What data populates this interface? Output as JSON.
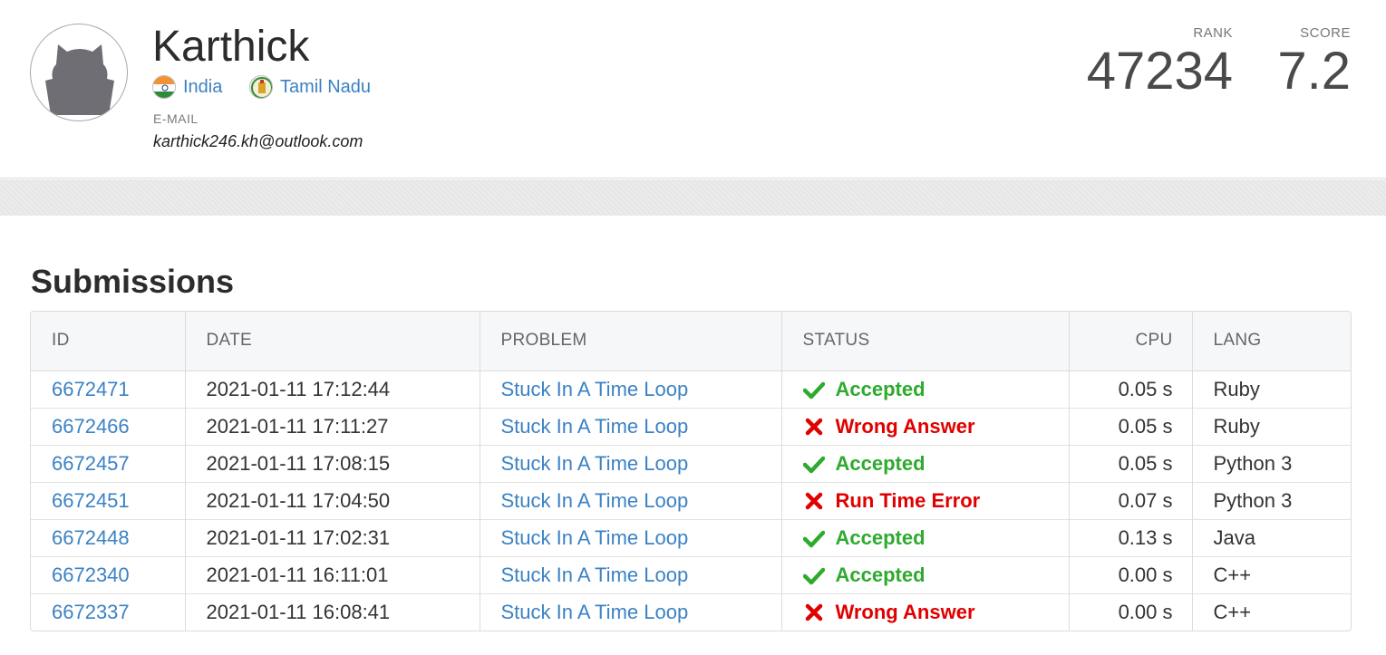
{
  "profile": {
    "name": "Karthick",
    "country": "India",
    "state": "Tamil Nadu",
    "email_label": "E-MAIL",
    "email": "karthick246.kh@outlook.com",
    "rank_label": "RANK",
    "rank": "47234",
    "score_label": "SCORE",
    "score": "7.2"
  },
  "submissions": {
    "title": "Submissions",
    "headers": {
      "id": "ID",
      "date": "DATE",
      "problem": "PROBLEM",
      "status": "STATUS",
      "cpu": "CPU",
      "lang": "LANG"
    },
    "rows": [
      {
        "id": "6672471",
        "date": "2021-01-11 17:12:44",
        "problem": "Stuck In A Time Loop",
        "status": "Accepted",
        "cpu": "0.05 s",
        "lang": "Ruby"
      },
      {
        "id": "6672466",
        "date": "2021-01-11 17:11:27",
        "problem": "Stuck In A Time Loop",
        "status": "Wrong Answer",
        "cpu": "0.05 s",
        "lang": "Ruby"
      },
      {
        "id": "6672457",
        "date": "2021-01-11 17:08:15",
        "problem": "Stuck In A Time Loop",
        "status": "Accepted",
        "cpu": "0.05 s",
        "lang": "Python 3"
      },
      {
        "id": "6672451",
        "date": "2021-01-11 17:04:50",
        "problem": "Stuck In A Time Loop",
        "status": "Run Time Error",
        "cpu": "0.07 s",
        "lang": "Python 3"
      },
      {
        "id": "6672448",
        "date": "2021-01-11 17:02:31",
        "problem": "Stuck In A Time Loop",
        "status": "Accepted",
        "cpu": "0.13 s",
        "lang": "Java"
      },
      {
        "id": "6672340",
        "date": "2021-01-11 16:11:01",
        "problem": "Stuck In A Time Loop",
        "status": "Accepted",
        "cpu": "0.00 s",
        "lang": "C++"
      },
      {
        "id": "6672337",
        "date": "2021-01-11 16:08:41",
        "problem": "Stuck In A Time Loop",
        "status": "Wrong Answer",
        "cpu": "0.00 s",
        "lang": "C++"
      }
    ]
  },
  "colors": {
    "link": "#3b82c4",
    "accepted": "#2eaa2e",
    "error": "#e00000"
  },
  "icons": {
    "accepted": "checkmark-icon",
    "rejected": "cross-icon"
  }
}
